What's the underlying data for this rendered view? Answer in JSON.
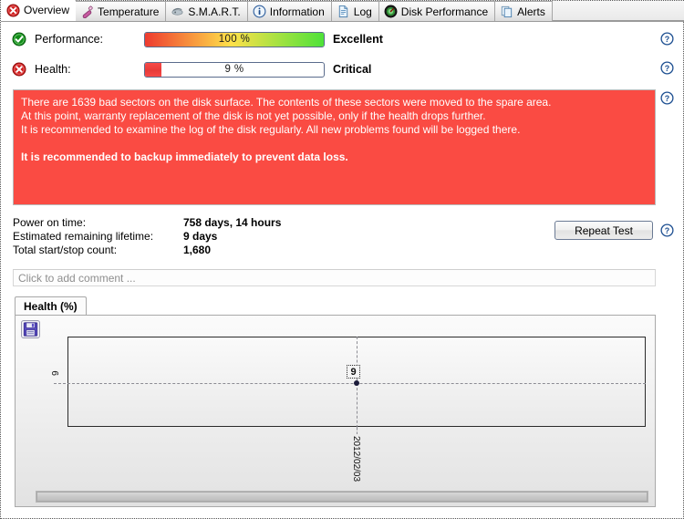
{
  "tabs": [
    {
      "label": "Overview",
      "icon": "error-circle-icon",
      "active": true
    },
    {
      "label": "Temperature",
      "icon": "thermometer-icon",
      "active": false
    },
    {
      "label": "S.M.A.R.T.",
      "icon": "smart-chip-icon",
      "active": false
    },
    {
      "label": "Information",
      "icon": "info-circle-icon",
      "active": false
    },
    {
      "label": "Log",
      "icon": "document-icon",
      "active": false
    },
    {
      "label": "Disk Performance",
      "icon": "gauge-icon",
      "active": false
    },
    {
      "label": "Alerts",
      "icon": "copy-pages-icon",
      "active": false
    }
  ],
  "meters": {
    "performance": {
      "label": "Performance:",
      "value_text": "100 %",
      "percent": 100,
      "verdict": "Excellent",
      "status_icon": "green-check-icon",
      "bar_start_color": "#ee3b30",
      "bar_mid_color": "#ffe14a",
      "bar_end_color": "#4ee23a"
    },
    "health": {
      "label": "Health:",
      "value_text": "9 %",
      "percent": 9,
      "verdict": "Critical",
      "status_icon": "red-x-icon",
      "fill_color": "#f74a48"
    }
  },
  "warning": {
    "background_color": "#fa4b43",
    "lines": [
      "There are 1639 bad sectors on the disk surface. The contents of these sectors were moved to the spare area.",
      "At this point, warranty replacement of the disk is not yet possible, only if the health drops further.",
      "It is recommended to examine the log of the disk regularly. All new problems found will be logged there."
    ],
    "emphasis": "It is recommended to backup immediately to prevent data loss."
  },
  "stats": [
    {
      "key": "Power on time:",
      "value": "758 days, 14 hours"
    },
    {
      "key": "Estimated remaining lifetime:",
      "value": "9 days"
    },
    {
      "key": "Total start/stop count:",
      "value": "1,680"
    }
  ],
  "repeat_test": {
    "label": "Repeat Test"
  },
  "comment": {
    "placeholder": "Click to add comment ...",
    "value": ""
  },
  "help_icons": [
    "help-icon-performance",
    "help-icon-health",
    "help-icon-warning",
    "help-icon-repeat-test"
  ],
  "chart_panel": {
    "tab_label": "Health (%)",
    "save_icon": "save-floppy-icon"
  },
  "chart_data": {
    "type": "line",
    "title": "Health (%)",
    "xlabel": "",
    "ylabel": "",
    "x": [
      "2012/02/03"
    ],
    "values": [
      9
    ],
    "point_labels": [
      "9"
    ],
    "ytick_labels": [
      "9"
    ],
    "xtick_labels": [
      "2012/02/03"
    ],
    "ylim": [
      0,
      100
    ],
    "grid": true,
    "legend": "none"
  }
}
